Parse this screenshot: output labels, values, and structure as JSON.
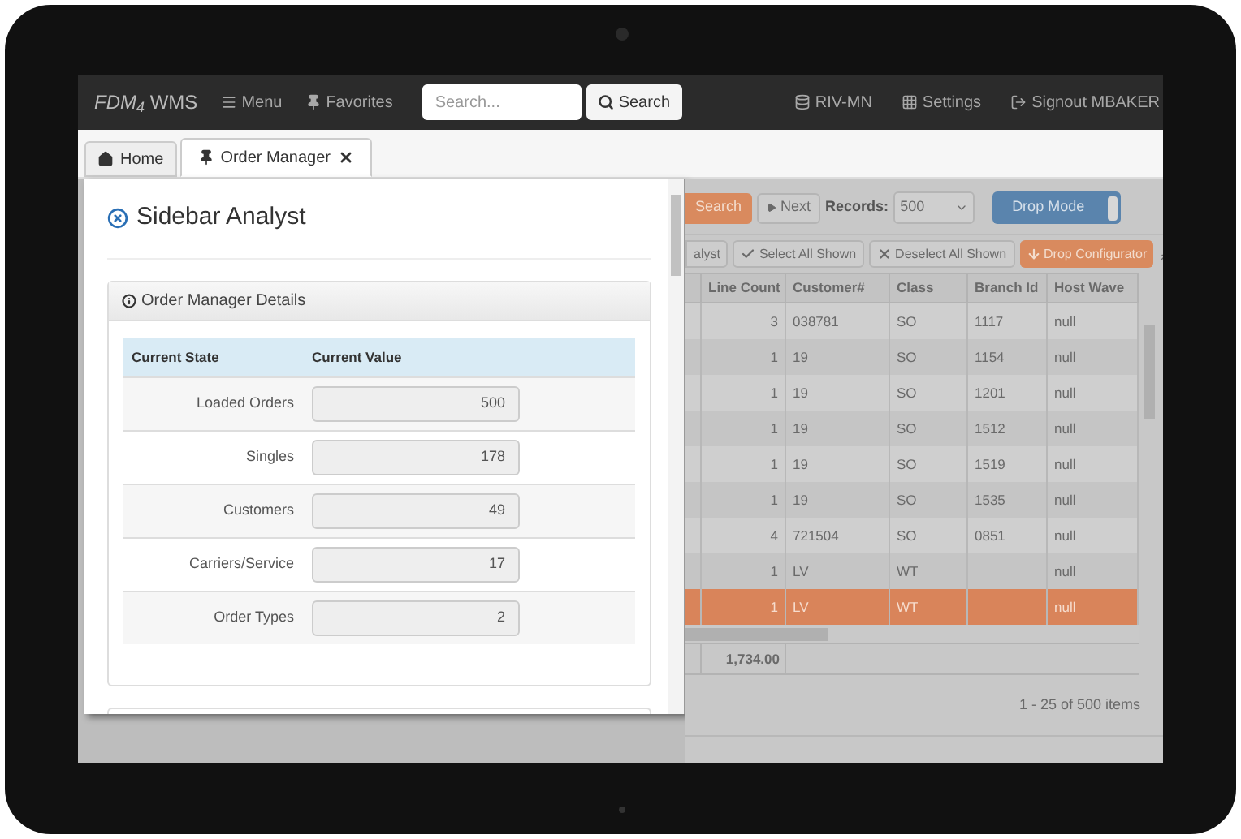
{
  "navbar": {
    "brand": "*FDM$_{4}$* WMS",
    "menu": "Menu",
    "favorites": "Favorites",
    "search": {
      "placeholder": "Search..."
    },
    "search_button": "Search",
    "site": "RIV-MN",
    "settings": "Settings",
    "signout": "Signout MBAKER"
  },
  "tabs": [
    {
      "label": "Home",
      "kind": "home",
      "selected": false,
      "closable": false
    },
    {
      "label": "Order Manager",
      "kind": "pin",
      "selected": true,
      "closable": true
    }
  ],
  "sidebar": {
    "title": "Sidebar Analyst",
    "card_title": "Order Manager Details",
    "columns": [
      "Current State",
      "Current Value"
    ],
    "rows": [
      {
        "label": "Loaded Orders",
        "value": "500"
      },
      {
        "label": "Singles",
        "value": "178"
      },
      {
        "label": "Customers",
        "value": "49"
      },
      {
        "label": "Carriers/Service",
        "value": "17"
      },
      {
        "label": "Order Types",
        "value": "2"
      }
    ]
  },
  "grid": {
    "toolbar": {
      "search": "Search",
      "next": "Next",
      "records_label": "Records:",
      "records": "500",
      "drop_mode": {
        "label": "Drop Mode",
        "on": true
      }
    },
    "actions": [
      {
        "label": "alyst",
        "kind": "plain"
      },
      {
        "label": "Select All Shown",
        "kind": "check"
      },
      {
        "label": "Deselect All Shown",
        "kind": "cross"
      },
      {
        "label": "Drop Configurator",
        "kind": "download"
      }
    ],
    "columns": [
      "Line Count",
      "Customer#",
      "Class",
      "Branch Id",
      "Host Wave"
    ],
    "rows": [
      {
        "cells": [
          "3",
          "038781",
          "SO",
          "1117",
          "null"
        ],
        "selected": false
      },
      {
        "cells": [
          "1",
          "19",
          "SO",
          "1154",
          "null"
        ],
        "selected": false
      },
      {
        "cells": [
          "1",
          "19",
          "SO",
          "1201",
          "null"
        ],
        "selected": false
      },
      {
        "cells": [
          "1",
          "19",
          "SO",
          "1512",
          "null"
        ],
        "selected": false
      },
      {
        "cells": [
          "1",
          "19",
          "SO",
          "1519",
          "null"
        ],
        "selected": false
      },
      {
        "cells": [
          "1",
          "19",
          "SO",
          "1535",
          "null"
        ],
        "selected": false
      },
      {
        "cells": [
          "4",
          "721504",
          "SO",
          "0851",
          "null"
        ],
        "selected": false
      },
      {
        "cells": [
          "1",
          "LV",
          "WT",
          "",
          "null"
        ],
        "selected": false
      },
      {
        "cells": [
          "1",
          "LV",
          "WT",
          "",
          "null"
        ],
        "selected": true
      }
    ],
    "total": "1,734.00",
    "pager": "1 - 25 of 500 items"
  }
}
